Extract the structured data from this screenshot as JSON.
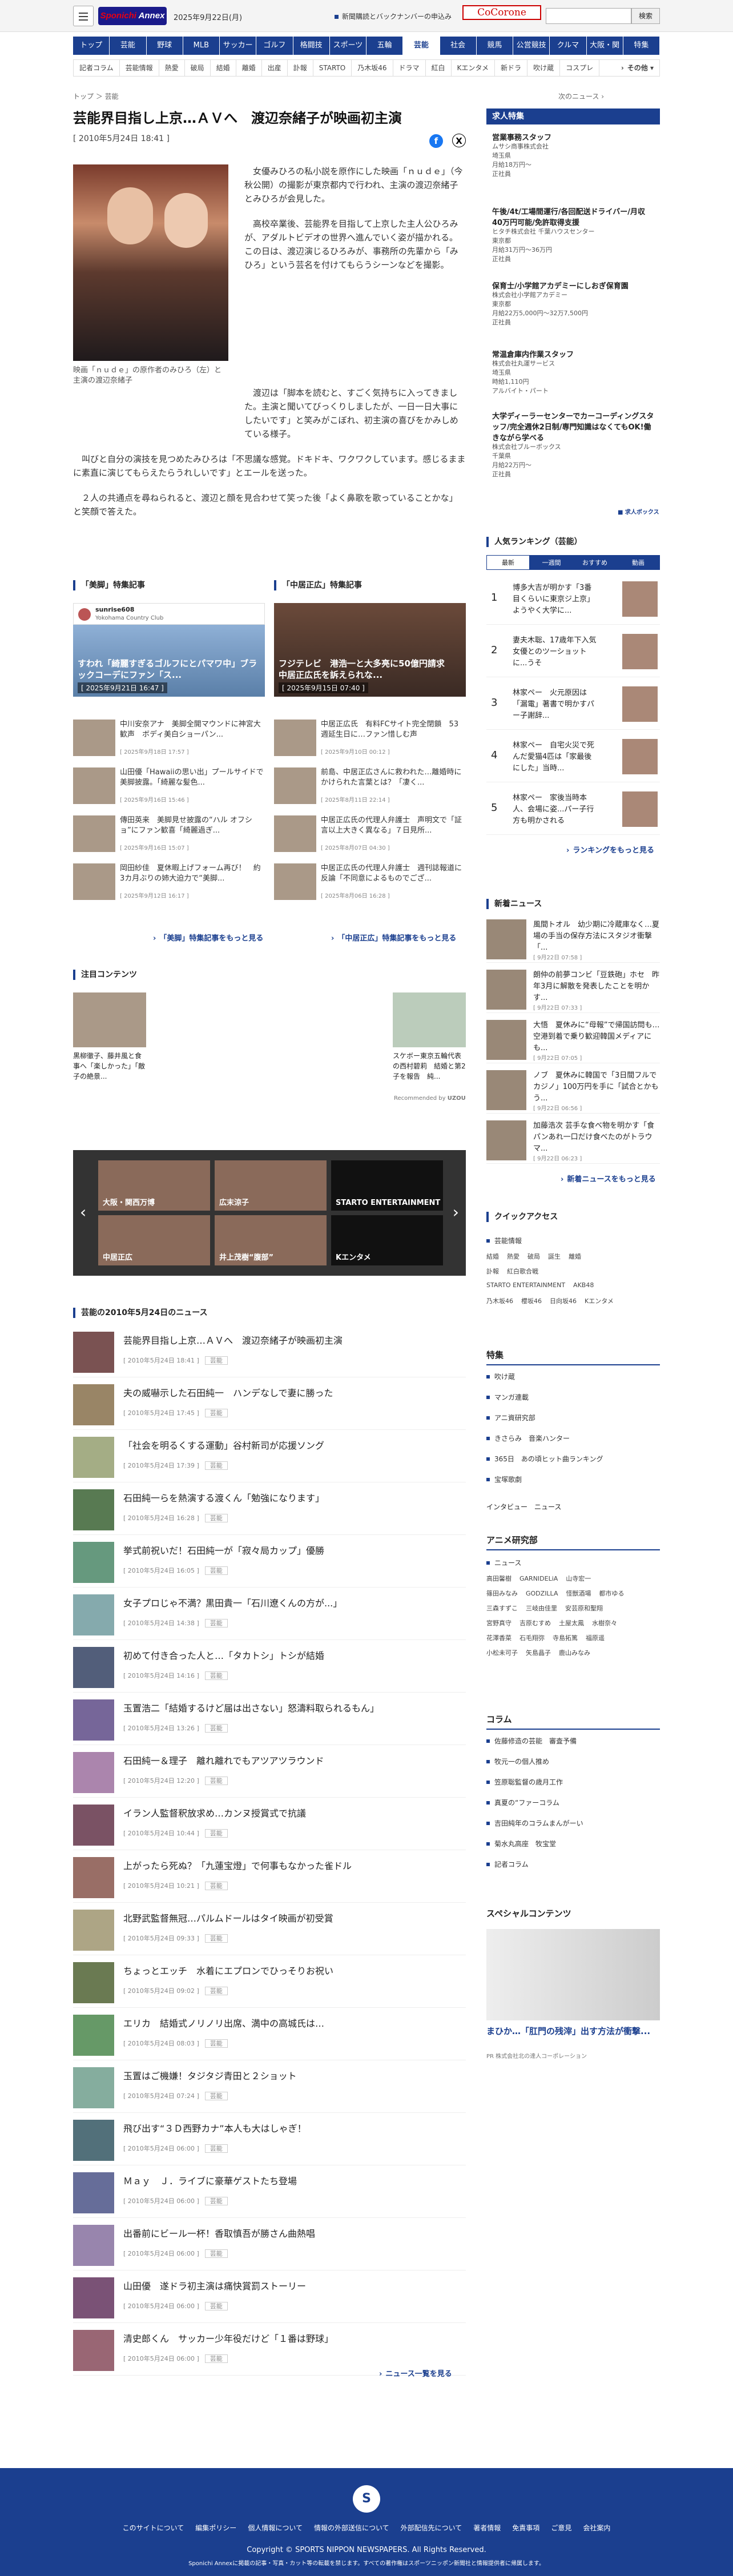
{
  "header": {
    "logo_main": "Sponichi",
    "logo_sub": "Annex",
    "date": "2025年9月22日(月)",
    "link": "新聞購読とバックナンバーの申込み",
    "cocorone": "CoCorone",
    "search_button": "検索"
  },
  "nav": [
    "トップ",
    "芸能",
    "野球",
    "MLB",
    "サッカー",
    "ゴルフ",
    "格闘技",
    "スポーツ",
    "五輪",
    "芸能",
    "社会",
    "競馬",
    "公営競技",
    "クルマ",
    "大阪・関西",
    "特集"
  ],
  "subnav": [
    "記者コラム",
    "芸能情報",
    "熱愛",
    "破局",
    "結婚",
    "離婚",
    "出産",
    "訃報",
    "STARTO",
    "乃木坂46",
    "ドラマ",
    "紅白",
    "Kエンタメ",
    "新ドラ",
    "吹け蔵",
    "コスプレ"
  ],
  "subnav_more": "その他 ▾",
  "breadcrumb": "トップ ＞ 芸能",
  "next_news": "次のニュース ›",
  "article": {
    "title": "芸能界目指し上京…ＡＶへ　渡辺奈緒子が映画初主演",
    "date": "[ 2010年5月24日 18:41 ]",
    "caption": "映画「ｎｕｄｅ」の原作者のみひろ（左）と主演の渡辺奈緒子",
    "paras": [
      "女優みひろの私小説を原作にした映画「ｎｕｄｅ」（今秋公開）の撮影が東京都内で行われ、主演の渡辺奈緒子とみひろが会見した。",
      "高校卒業後、芸能界を目指して上京した主人公ひろみが、アダルトビデオの世界へ進んでいく姿が描かれる。この日は、渡辺演じるひろみが、事務所の先輩から「みひろ」という芸名を付けてもらうシーンなどを撮影。",
      "渡辺は「脚本を読むと、すごく気持ちに入ってきました。主演と聞いてびっくりしましたが、一日一日大事にしたいです」と笑みがこぼれ、初主演の喜びをかみしめている様子。",
      "叫びと自分の演技を見つめたみひろは「不思議な感覚。ドキドキ、ワクワクしています。感じるままに素直に演じてもらえたらうれしいです」とエールを送った。",
      "２人の共通点を尋ねられると、渡辺と顔を見合わせて笑った後「よく鼻歌を歌っていることかな」と笑顔で答えた。"
    ]
  },
  "feature_left": {
    "header": "「美脚」特集記事",
    "account": "sunrise608",
    "account_sub": "Yokohama Country Club",
    "feat_label": "すわれ「綺麗すぎるゴルフにとパマワ中」ブラックコーデにファン「ス...",
    "feat_date": "[ 2025年9月21日 16:47 ]",
    "items": [
      {
        "t": "中川安奈アナ　美脚全開マウンドに神宮大歓声　ボディ美白ショーパン...",
        "d": "[ 2025年9月18日 17:57 ]"
      },
      {
        "t": "山田優「Hawaiiの思い出」プールサイドで美脚披露。「綺麗な髪色...",
        "d": "[ 2025年9月16日 15:46 ]"
      },
      {
        "t": "傳田英来　美脚見せ披露の“ハル オフショ”にファン歓喜「綺麗過ぎ...",
        "d": "[ 2025年9月16日 15:07 ]"
      },
      {
        "t": "岡田紗佳　夏休暇上げフォーム再び！　約3カ月ぶりの姉大迫力で“美脚...",
        "d": "[ 2025年9月12日 16:17 ]"
      }
    ],
    "more": "「美脚」特集記事をもっと見る"
  },
  "feature_right": {
    "header": "「中居正広」特集記事",
    "feat_label": "フジテレビ　港浩一と大多亮に50億円請求　中居正広氏を訴えられな...",
    "feat_date": "[ 2025年9月15日 07:40 ]",
    "items": [
      {
        "t": "中居正広氏　有料FCサイト完全閉鎖　53週延生日に…ファン惜しむ声",
        "d": "[ 2025年9月10日 00:12 ]"
      },
      {
        "t": "前島、中居正広さんに救われた…離婚時にかけられた言葉とは？「凄く...",
        "d": "[ 2025年8月11日 22:14 ]"
      },
      {
        "t": "中居正広氏の代理人弁護士　声明文で「証言以上大きく異なる」７日見所...",
        "d": "[ 2025年8月07日 04:30 ]"
      },
      {
        "t": "中居正広氏の代理人弁護士　週刊誌報道に反論「不同意によるものでござ...",
        "d": "[ 2025年8月06日 16:28 ]"
      }
    ],
    "more": "「中居正広」特集記事をもっと見る"
  },
  "attention": {
    "header": "注目コンテンツ",
    "left_caption": "黒柳徹子、藤井風と食事へ「楽しかった」「敵子の絶景...",
    "right_caption": "スケボー東京五輪代表の西村碧莉　結婚と第2子を報告　純...",
    "recommended": "Recommended by",
    "uzou": "UZOU"
  },
  "carousel": [
    "大阪・関西万博",
    "広末涼子",
    "STARTO ENTERTAINMENT",
    "中居正広",
    "井上茂樹“腹部”",
    "Kエンタメ"
  ],
  "news_header": "芸能の2010年5月24日のニュース",
  "news": [
    {
      "t": "芸能界目指し上京…ＡＶへ　渡辺奈緒子が映画初主演",
      "d": "[ 2010年5月24日 18:41 ]"
    },
    {
      "t": "夫の威嚇示した石田純一　ハンデなしで妻に勝った",
      "d": "[ 2010年5月24日 17:45 ]"
    },
    {
      "t": "「社会を明るくする運動」谷村新司が応援ソング",
      "d": "[ 2010年5月24日 17:39 ]"
    },
    {
      "t": "石田純一らを熱演する渡くん「勉強になります」",
      "d": "[ 2010年5月24日 16:28 ]"
    },
    {
      "t": "挙式前祝いだ！石田純一が「寂々局カップ」優勝",
      "d": "[ 2010年5月24日 16:05 ]"
    },
    {
      "t": "女子プロじゃ不満？黒田貴一「石川遼くんの方が...」",
      "d": "[ 2010年5月24日 14:38 ]"
    },
    {
      "t": "初めて付き合った人と…「タカトシ」トシが結婚",
      "d": "[ 2010年5月24日 14:16 ]"
    },
    {
      "t": "玉置浩二「結婚するけど届は出さない」怒濤料取られるもん」",
      "d": "[ 2010年5月24日 13:26 ]"
    },
    {
      "t": "石田純一＆理子　離れ離れでもアツアツラウンド",
      "d": "[ 2010年5月24日 12:20 ]"
    },
    {
      "t": "イラン人監督釈放求め…カンヌ授賞式で抗議",
      "d": "[ 2010年5月24日 10:44 ]"
    },
    {
      "t": "上がったら死ぬ？「九蓮宝燈」で何事もなかった雀ドル",
      "d": "[ 2010年5月24日 10:21 ]"
    },
    {
      "t": "北野武監督無冠…パルムドールはタイ映画が初受賞",
      "d": "[ 2010年5月24日 09:33 ]"
    },
    {
      "t": "ちょっとエッチ　水着にエプロンでひっそりお祝い",
      "d": "[ 2010年5月24日 09:02 ]"
    },
    {
      "t": "エリカ　結婚式ノリノリ出席、満中の高城氏は…",
      "d": "[ 2010年5月24日 08:03 ]"
    },
    {
      "t": "玉置はご機嫌！タジタジ青田と２ショット",
      "d": "[ 2010年5月24日 07:24 ]"
    },
    {
      "t": "飛び出す“３Ｄ西野カナ”本人も大はしゃぎ！",
      "d": "[ 2010年5月24日 06:00 ]"
    },
    {
      "t": "Ｍａｙ　Ｊ．ライブに豪華ゲストたち登場",
      "d": "[ 2010年5月24日 06:00 ]"
    },
    {
      "t": "出番前にビール一杯！香取慎吾が勝さん曲熱唱",
      "d": "[ 2010年5月24日 06:00 ]"
    },
    {
      "t": "山田優　遂ドラ初主演は痛快賞罰ストーリー",
      "d": "[ 2010年5月24日 06:00 ]"
    },
    {
      "t": "清史郎くん　サッカー少年役だけど「１番は野球」",
      "d": "[ 2010年5月24日 06:00 ]"
    }
  ],
  "news_tag": "芸能",
  "news_more": "ニュース一覧を見る",
  "side": {
    "jobs_header": "求人特集",
    "jobs": [
      {
        "t": "営業事務スタッフ",
        "c": "ムサシ商事株式会社",
        "a": "埼玉県",
        "s": "月給18万円～",
        "k": "正社員"
      },
      {
        "t": "午後/4t/工場間運行/各回配送ドライバー/月収40万円可能/免許取得支援",
        "c": "ヒタチ株式会社 千葉ハウスセンター",
        "a": "東京都",
        "s": "月給31万円～36万円",
        "k": "正社員"
      },
      {
        "t": "保育士/小学館アカデミーにしおぎ保育園",
        "c": "株式会社小学館アカデミー",
        "a": "東京都",
        "s": "月給22万5,000円～32万7,500円",
        "k": "正社員"
      },
      {
        "t": "常温倉庫内作業スタッフ",
        "c": "株式会社丸運サービス",
        "a": "埼玉県",
        "s": "時給1,110円",
        "k": "アルバイト・パート"
      },
      {
        "t": "大学ディーラーセンターでカーコーディングスタッフ/完全週休2日制/専門知識はなくてもOK!働きながら学べる",
        "c": "株式会社ブルーボックス",
        "a": "千葉県",
        "s": "月給22万円～",
        "k": "正社員"
      }
    ],
    "rank_header": "人気ランキング（芸能）",
    "rank_tabs": [
      "最新",
      "一週間",
      "おすすめ",
      "動画"
    ],
    "ranks": [
      "博多大吉が明かす「3番目くらいに東京ジ上京」ようやく大学に...",
      "妻夫木聡、17歳年下入気女優とのツーショットに...うそ",
      "林家ペー　火元原因は「漏電」著書で明かすパー子謝辞...",
      "林家ペー　自宅火災で死んだ愛猫4匹は「家最後にした」当時...",
      "林家ペー　家後当時本人、会場に姿...パー子行方も明かされる"
    ],
    "rank_more": "ランキングをもっと見る",
    "snews_header": "新着ニュース",
    "snews": [
      {
        "t": "風間トオル　幼少期に冷蔵庫なく…夏場の手当の保存方法にスタジオ衝撃「...",
        "d": "[ 9月22日 07:58 ]"
      },
      {
        "t": "朗仲の前夢コンビ「豆鉄砲」ホセ　昨年3月に解散を発表したことを明かす...",
        "d": "[ 9月22日 07:33 ]"
      },
      {
        "t": "大悟　夏休みに“母報”で帰国訪問も…空港到着で乗り歓迎韓国メディアにも...",
        "d": "[ 9月22日 07:05 ]"
      },
      {
        "t": "ノブ　夏休みに韓国で「3日間フルでカジノ」100万円を手に「試合とかもう...",
        "d": "[ 9月22日 06:56 ]"
      },
      {
        "t": "加藤浩次 芸手な食べ物を明かす「食パンあれ一口だけ食べたのがトラウマ...",
        "d": "[ 9月22日 06:23 ]"
      }
    ],
    "snews_more": "新着ニュースをもっと見る",
    "quick_header": "クイックアクセス",
    "quick_bullet": "芸能情報",
    "quick_tags": [
      [
        "結婚",
        "熱愛",
        "破局",
        "誕生",
        "離婚"
      ],
      [
        "訃報",
        "紅白歌合戦"
      ],
      [
        "STARTO ENTERTAINMENT",
        "AKB48"
      ],
      [
        "乃木坂46",
        "櫻坂46",
        "日向坂46",
        "Kエンタメ"
      ]
    ],
    "feature_header": "特集",
    "features": [
      "吹け蔵",
      "マンガ連載",
      "アニ資研究部",
      "きさらみ　音楽ハンター",
      "365日　あの頃ヒット曲ランキング",
      "宝塚歌劇"
    ],
    "feature_tail": "インタビュー　ニュース",
    "anime_header": "アニメ研究部",
    "anime_bullet": "ニュース",
    "anime_tags": [
      [
        "高田馨樹",
        "GARNIDELiA",
        "山寺宏一"
      ],
      [
        "篠田みなみ",
        "GODZILLA",
        "怪獣酒場",
        "都市ゆる"
      ],
      [
        "三森すずこ",
        "三岐由佳里",
        "安芸原和聖翔"
      ],
      [
        "宮野真守",
        "吉原むすめ",
        "土屋太鳳",
        "水樹奈々"
      ],
      [
        "花澤香菜",
        "石毛翔弥",
        "寺島拓篤",
        "福原遥"
      ],
      [
        "小松未可子",
        "矢島晶子",
        "鹿山みなみ"
      ]
    ],
    "column_header": "コラム",
    "columns": [
      "佐藤修造の芸能　審査予備",
      "牧元一の個人推め",
      "笠原聡監督の歳月工作",
      "真夏の“ファーコラム",
      "吉田純年のコラムまんがーい",
      "菊水丸高座　牧宝堂",
      "記者コラム"
    ],
    "special_header": "スペシャルコンテンツ",
    "special_caption": "まひか…「肛門の残滓」出す方法が衝撃...",
    "special_sub": "PR 株式会社北の達人コーポレーション"
  },
  "footer": {
    "links": [
      "このサイトについて",
      "編集ポリシー",
      "個人情報について",
      "情報の外部送信について",
      "外部配信先について",
      "著者情報",
      "免責事項",
      "ご意見",
      "会社案内"
    ],
    "copyright": "Copyright © SPORTS NIPPON NEWSPAPERS. All Rights Reserved.",
    "note": "Sponichi Annexに掲載の記事・写真・カット等の転載を禁じます。すべての著作権はスポーツニッポン新聞社と情報提供者に帰属します。"
  },
  "colors": {
    "brand": "#1b3f8f",
    "accent": "#e60012",
    "facebook": "#1877f2"
  }
}
